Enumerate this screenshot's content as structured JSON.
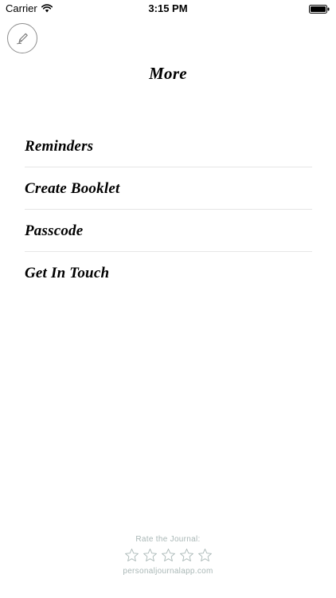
{
  "status_bar": {
    "carrier": "Carrier",
    "time": "3:15 PM",
    "icons": [
      "wifi-icon",
      "battery-icon"
    ]
  },
  "header": {
    "compose_icon": "pencil-icon",
    "title": "More"
  },
  "menu": {
    "items": [
      {
        "label": "Reminders"
      },
      {
        "label": "Create Booklet"
      },
      {
        "label": "Passcode"
      },
      {
        "label": "Get In Touch"
      }
    ]
  },
  "footer": {
    "rate_label": "Rate the Journal:",
    "star_icon": "star-outline-icon",
    "star_count": 5,
    "site": "personaljournalapp.com"
  },
  "colors": {
    "footer_text": "#a9b7b6",
    "divider": "#e6e6e6",
    "compose_border": "#8e8e8e"
  }
}
